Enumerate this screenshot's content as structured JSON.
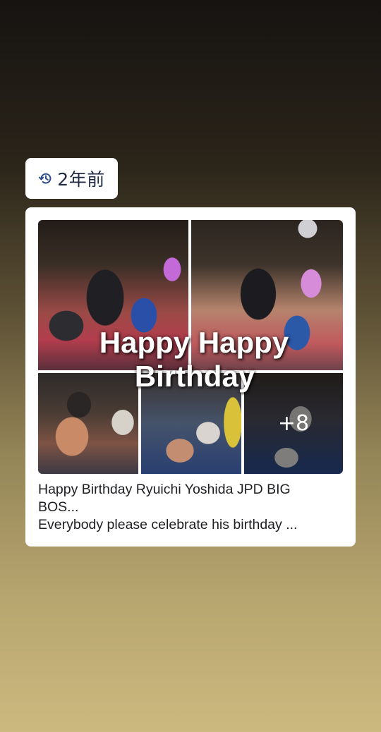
{
  "memory": {
    "time_ago": "2年前",
    "icon": "history-icon"
  },
  "post": {
    "overlay_line1": "Happy Happy",
    "overlay_line2": "Birthday",
    "more_count": "+8",
    "caption_line1": "Happy Birthday Ryuichi Yoshida JPD BIG",
    "caption_line2": "BOS...",
    "caption_line3": "Everybody please celebrate his birthday ..."
  },
  "colors": {
    "card_bg": "#ffffff",
    "text": "#1c1e21",
    "icon_blue": "#2f4b8a"
  }
}
